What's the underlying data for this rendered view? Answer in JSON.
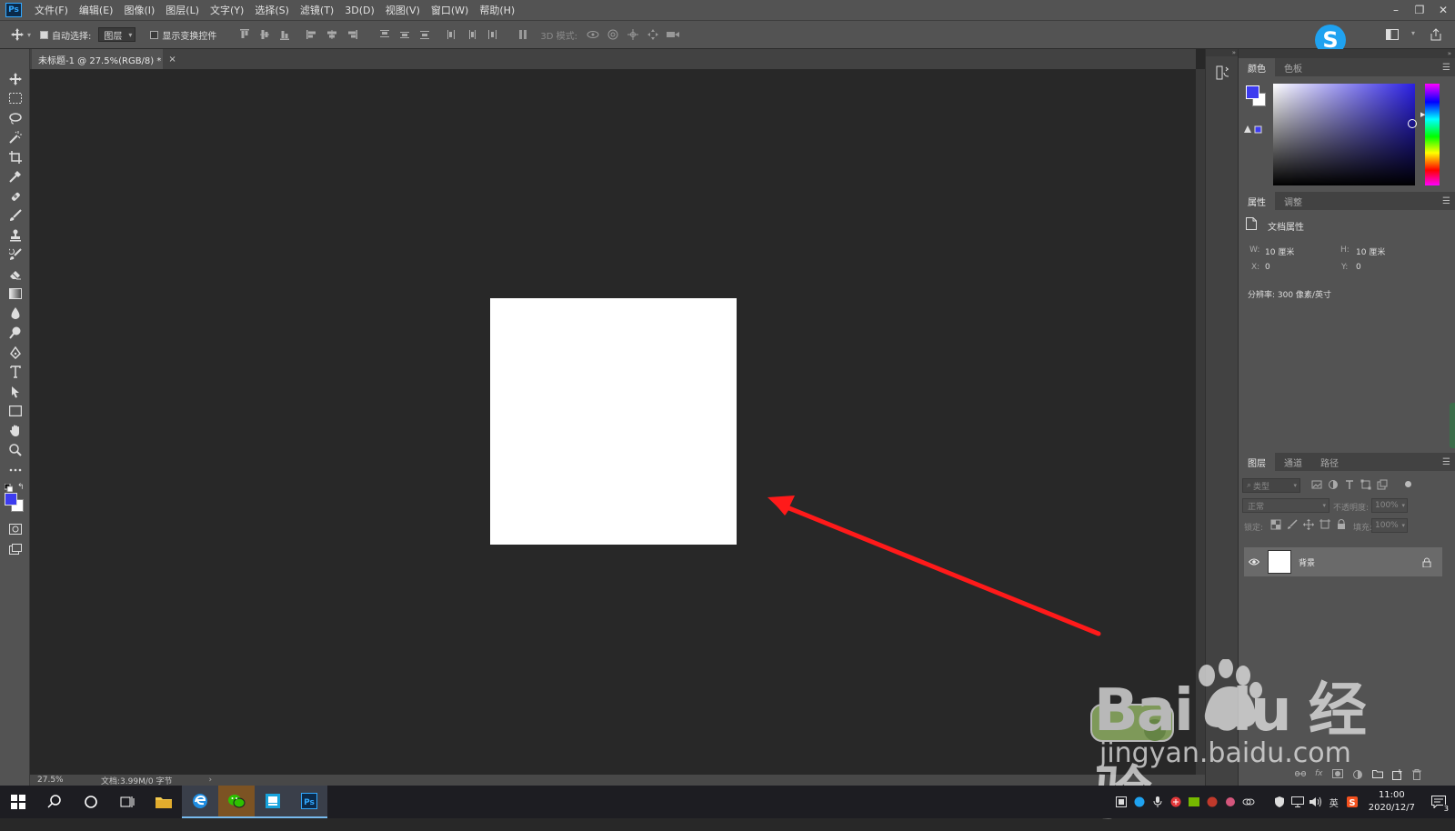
{
  "app": {
    "logo_text": "Ps",
    "menus": [
      "文件(F)",
      "编辑(E)",
      "图像(I)",
      "图层(L)",
      "文字(Y)",
      "选择(S)",
      "滤镜(T)",
      "3D(D)",
      "视图(V)",
      "窗口(W)",
      "帮助(H)"
    ]
  },
  "options_bar": {
    "auto_select_label": "自动选择:",
    "auto_select_checked": true,
    "auto_select_target": "图层",
    "show_transform_label": "显示变换控件",
    "show_transform_checked": false,
    "mode_3d_label": "3D 模式:"
  },
  "document": {
    "tab_title": "未标题-1 @ 27.5%(RGB/8) *",
    "zoom": "27.5%",
    "doc_info": "文档:3.99M/0 字节",
    "canvas_color": "#ffffff"
  },
  "color_panel": {
    "tabs": [
      "颜色",
      "色板"
    ],
    "foreground": "#3d3cf0",
    "background": "#ffffff"
  },
  "properties_panel": {
    "tabs": [
      "属性",
      "调整"
    ],
    "section_title": "文档属性",
    "width_label": "W:",
    "width_value": "10 厘米",
    "height_label": "H:",
    "height_value": "10 厘米",
    "x_label": "X:",
    "x_value": "0",
    "y_label": "Y:",
    "y_value": "0",
    "resolution": "分辨率: 300 像素/英寸"
  },
  "layers_panel": {
    "tabs": [
      "图层",
      "通道",
      "路径"
    ],
    "filter_placeholder": "类型",
    "blend_mode": "正常",
    "opacity_label": "不透明度:",
    "opacity_value": "100%",
    "lock_label": "锁定:",
    "fill_label": "填充:",
    "fill_value": "100%",
    "layers": [
      {
        "name": "背景",
        "visible": true,
        "locked": true
      }
    ]
  },
  "taskbar": {
    "apps": [
      "windows-start",
      "search",
      "cortana",
      "task-view",
      "file-explorer",
      "edge",
      "wechat",
      "app-blue",
      "photoshop"
    ],
    "time": "11:00",
    "date": "2020/12/7",
    "ime": "英",
    "notification_count": "3"
  },
  "watermark": {
    "brand": "Bai du 经验",
    "url": "jingyan.baidu.com"
  },
  "annotation": {
    "arrow_color": "#ff1a1a"
  }
}
